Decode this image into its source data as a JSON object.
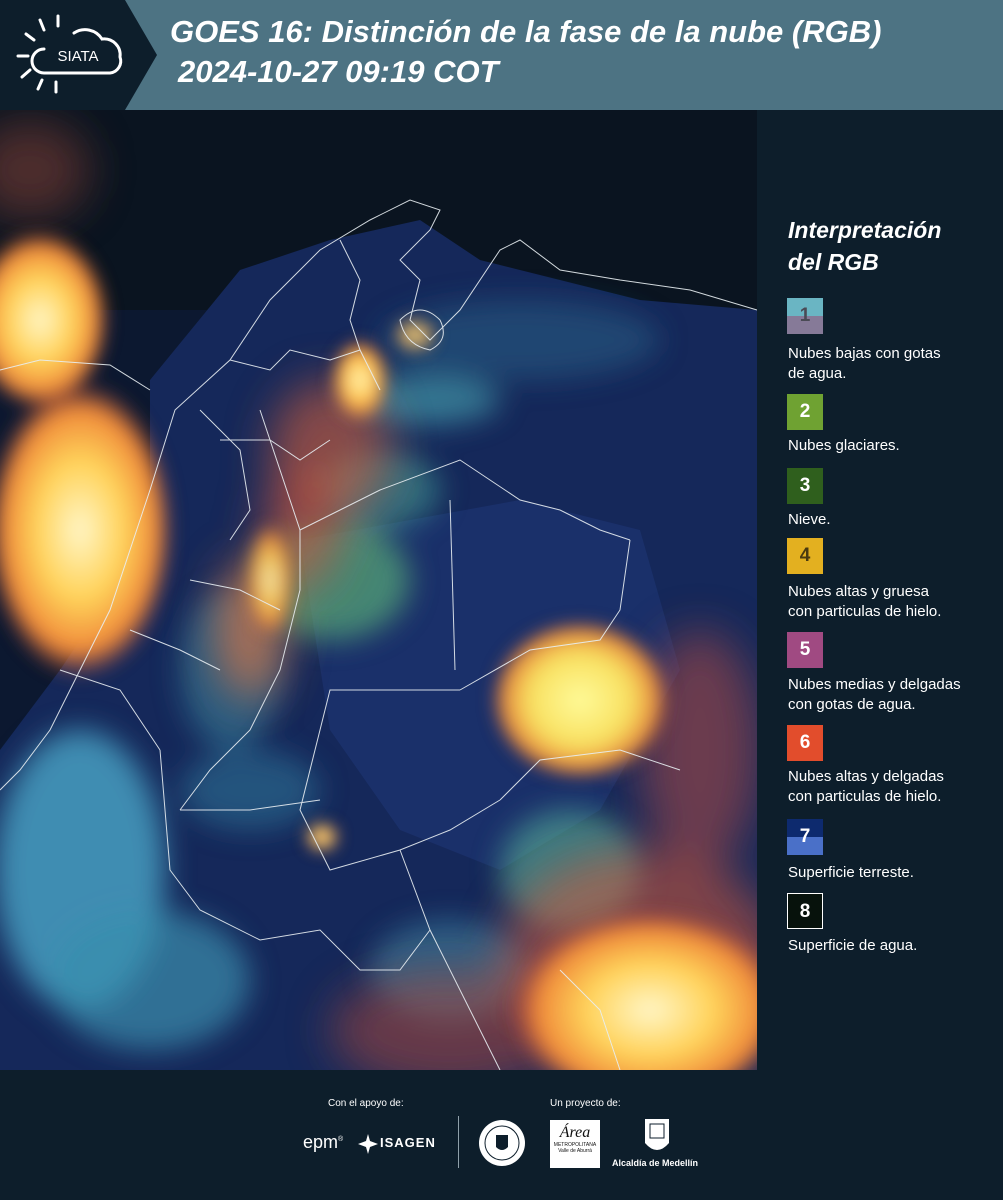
{
  "header": {
    "logo_text": "SIATA",
    "title_line1": "GOES 16: Distinción de la fase de la nube (RGB)",
    "title_line2": "2024-10-27 09:19 COT"
  },
  "legend": {
    "title_line1": "Interpretación",
    "title_line2": "del RGB",
    "items": [
      {
        "number": "1",
        "label_line1": "Nubes bajas con gotas",
        "label_line2": "de agua.",
        "color_top": "#6ab5c3",
        "color_bottom": "#867a98"
      },
      {
        "number": "2",
        "label_line1": "Nubes glaciares.",
        "label_line2": "",
        "color": "#6fa232"
      },
      {
        "number": "3",
        "label_line1": "Nieve.",
        "label_line2": "",
        "color": "#2f5f1d"
      },
      {
        "number": "4",
        "label_line1": "Nubes altas y gruesa",
        "label_line2": "con particulas de hielo.",
        "color": "#e3b020"
      },
      {
        "number": "5",
        "label_line1": "Nubes medias y delgadas",
        "label_line2": "con gotas de agua.",
        "color": "#a04a82"
      },
      {
        "number": "6",
        "label_line1": "Nubes altas y delgadas",
        "label_line2": "con particulas de hielo.",
        "color": "#e24d2c"
      },
      {
        "number": "7",
        "label_line1": "Superficie terreste.",
        "label_line2": "",
        "color_top": "#0d2a6e",
        "color_bottom": "#4a70c8"
      },
      {
        "number": "8",
        "label_line1": "Superficie de agua.",
        "label_line2": "",
        "color": "#07120c"
      }
    ]
  },
  "footer": {
    "support_label": "Con el apoyo de:",
    "project_label": "Un proyecto de:",
    "sponsor1": "epm",
    "sponsor1_mark": "®",
    "sponsor2": "ISAGEN",
    "partner_area": "Área",
    "partner_area_sub1": "METROPOLITANA",
    "partner_area_sub2": "Valle de Aburrá",
    "partner_alcaldia": "Alcaldía de Medellín"
  }
}
